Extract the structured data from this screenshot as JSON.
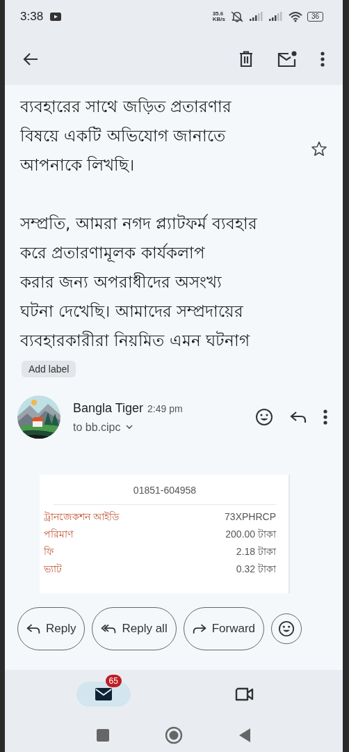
{
  "status_bar": {
    "time": "3:38",
    "speed": "35.6",
    "speed_unit": "KB/s",
    "battery": "36"
  },
  "body": {
    "paragraphs": [
      [
        "ব্যবহারের সাথে জড়িত প্রতারণার",
        "বিষয়ে একটি অভিযোগ জানাতে",
        "আপনাকে লিখছি।"
      ],
      [
        "সম্প্রতি, আমরা নগদ প্ল্যাটফর্ম ব্যবহার",
        "করে প্রতারণামূলক কার্যকলাপ",
        "করার জন্য অপরাধীদের অসংখ্য",
        "ঘটনা দেখেছি। আমাদের সম্প্রদায়ের",
        "ব্যবহারকারীরা নিয়মিত এমন ঘটনাগ"
      ]
    ],
    "starred": false
  },
  "label_chip": "Add label",
  "message": {
    "sender": "Bangla Tiger",
    "time": "2:49 pm",
    "recipient": "to bb.cipc"
  },
  "receipt": {
    "phone": "01851-604958",
    "rows": [
      {
        "label": "ট্রানজেকশন আইডি",
        "value": "73XPHRCP"
      },
      {
        "label": "পরিমাণ",
        "value": "200.00 টাকা"
      },
      {
        "label": "ফি",
        "value": "2.18 টাকা"
      },
      {
        "label": "ভ্যাট",
        "value": "0.32 টাকা"
      }
    ]
  },
  "actions": [
    {
      "kind": "reply",
      "label": "Reply"
    },
    {
      "kind": "reply_all",
      "label": "Reply all"
    },
    {
      "kind": "forward",
      "label": "Forward"
    },
    {
      "kind": "emoji"
    }
  ],
  "bottom_nav": [
    {
      "kind": "mail",
      "badge": "65",
      "selected": true
    },
    {
      "kind": "video",
      "selected": false
    }
  ]
}
